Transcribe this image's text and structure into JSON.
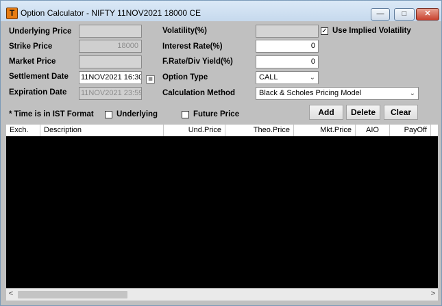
{
  "window": {
    "title": "Option Calculator - NIFTY 11NOV2021 18000 CE",
    "minimize_icon": "minimize-icon",
    "maximize_icon": "maximize-icon",
    "close_icon": "close-icon",
    "app_icon_letter": "T"
  },
  "form": {
    "underlying_price": {
      "label": "Underlying Price",
      "value": ""
    },
    "strike_price": {
      "label": "Strike Price",
      "value": "18000"
    },
    "market_price": {
      "label": "Market Price",
      "value": ""
    },
    "settlement_date": {
      "label": "Settlement Date",
      "value": "11NOV2021 16:30"
    },
    "expiration_date": {
      "label": "Expiration Date",
      "value": "11NOV2021 23:59"
    },
    "volatility": {
      "label": "Volatility(%)",
      "value": ""
    },
    "use_implied_volatility": {
      "label": "Use Implied Volatility",
      "checked": true
    },
    "interest_rate": {
      "label": "Interest Rate(%)",
      "value": "0"
    },
    "f_rate_div_yield": {
      "label": "F.Rate/Div Yield(%)",
      "value": "0"
    },
    "option_type": {
      "label": "Option Type",
      "value": "CALL"
    },
    "calculation_method": {
      "label": "Calculation Method",
      "value": "Black & Scholes Pricing Model"
    },
    "time_note": "* Time is in IST Format",
    "underlying_checkbox": {
      "label": "Underlying",
      "checked": false
    },
    "future_price_checkbox": {
      "label": "Future Price",
      "checked": false
    }
  },
  "buttons": {
    "add": "Add",
    "delete": "Delete",
    "clear": "Clear"
  },
  "grid": {
    "columns": [
      "Exch.",
      "Description",
      "Und.Price",
      "Theo.Price",
      "Mkt.Price",
      "AIO",
      "PayOff"
    ],
    "rows": []
  },
  "scrollbar": {
    "left_arrow": "<",
    "right_arrow": ">"
  }
}
